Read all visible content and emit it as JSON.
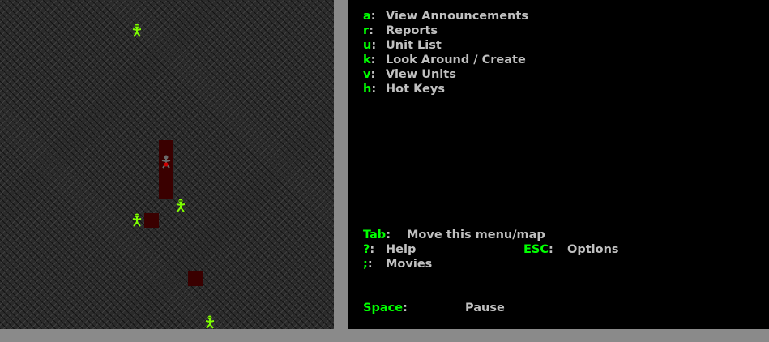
{
  "menu": {
    "items": [
      {
        "key": "a",
        "label": "View Announcements"
      },
      {
        "key": "r",
        "label": "Reports"
      },
      {
        "key": "u",
        "label": "Unit List"
      },
      {
        "key": "k",
        "label": "Look Around / Create"
      },
      {
        "key": "v",
        "label": "View Units"
      },
      {
        "key": "h",
        "label": "Hot Keys"
      }
    ],
    "tab": {
      "key": "Tab",
      "label": "Move this menu/map"
    },
    "help": {
      "key": "?",
      "label": "Help"
    },
    "esc": {
      "key": "ESC",
      "label": "Options"
    },
    "movies": {
      "key": ";",
      "label": "Movies"
    },
    "space": {
      "key": "Space",
      "label": "Pause"
    },
    "separator": ":"
  },
  "map": {
    "creature_icon": "green-humanoid-creature-icon",
    "wounded_icon": "wounded-creature-icon"
  },
  "colors": {
    "key": "#00ff00",
    "text": "#c0c0c0",
    "border": "#8a8a8a",
    "blood": "#3a0000"
  }
}
